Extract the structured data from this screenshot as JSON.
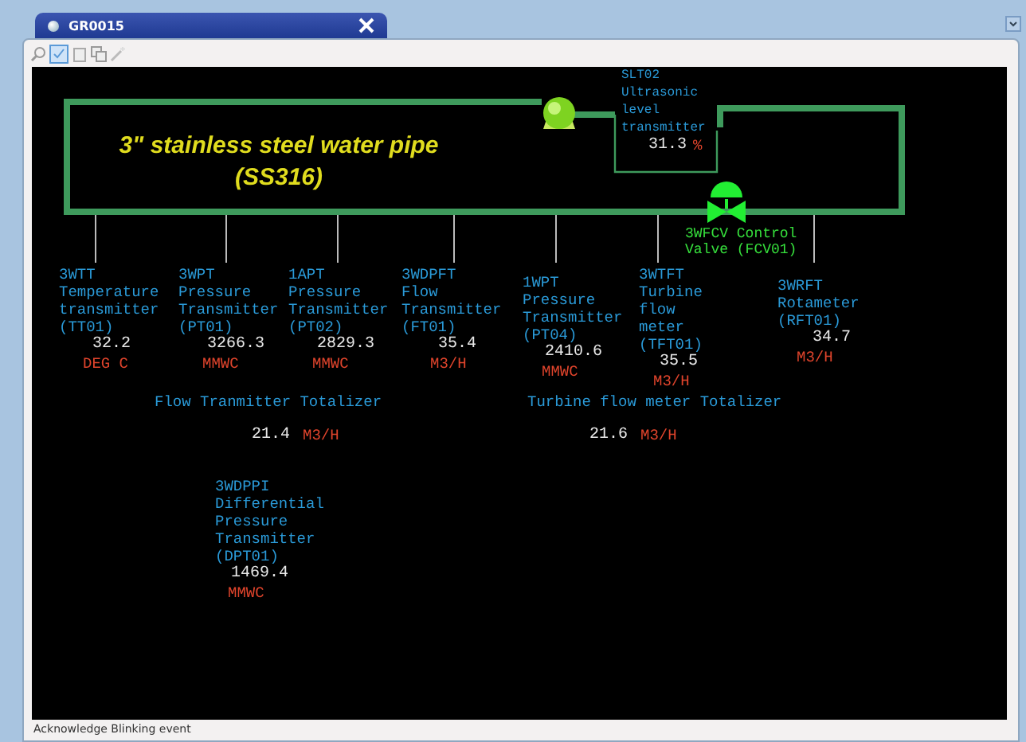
{
  "window": {
    "tab_title": "GR0015"
  },
  "pipe": {
    "label_lines": [
      "3\" stainless steel water pipe",
      "(SS316)"
    ]
  },
  "level_transmitter": {
    "label_lines": [
      "SLT02",
      "Ultrasonic",
      "level",
      "transmitter"
    ],
    "value": "31.3",
    "unit": "%"
  },
  "control_valve": {
    "label": "3WFCV Control Valve (FCV01)"
  },
  "instruments": [
    {
      "label_lines": [
        "3WTT",
        "Temperature",
        "transmitter",
        "(TT01)"
      ],
      "value": "32.2",
      "unit": "DEG C"
    },
    {
      "label_lines": [
        "3WPT",
        "Pressure",
        "Transmitter",
        "(PT01)"
      ],
      "value": "3266.3",
      "unit": "MMWC"
    },
    {
      "label_lines": [
        "1APT",
        "Pressure",
        "Transmitter",
        "(PT02)"
      ],
      "value": "2829.3",
      "unit": "MMWC"
    },
    {
      "label_lines": [
        "3WDPFT",
        "Flow",
        "Transmitter",
        "(FT01)"
      ],
      "value": "35.4",
      "unit": "M3/H"
    },
    {
      "label_lines": [
        "1WPT",
        "Pressure",
        "Transmitter",
        "(PT04)"
      ],
      "value": "2410.6",
      "unit": "MMWC"
    },
    {
      "label_lines": [
        "3WTFT",
        "Turbine",
        "flow",
        "meter",
        "(TFT01)"
      ],
      "value": "35.5",
      "unit": "M3/H"
    },
    {
      "label_lines": [
        "3WRFT",
        "Rotameter",
        "(RFT01)"
      ],
      "value": "34.7",
      "unit": "M3/H"
    },
    {
      "label_lines": [
        "3WDPPI",
        "Differential",
        "Pressure",
        "Transmitter",
        "(DPT01)"
      ],
      "value": "1469.4",
      "unit": "MMWC"
    }
  ],
  "totalizers": [
    {
      "label": "Flow Tranmitter Totalizer",
      "value": "21.4",
      "unit": "M3/H"
    },
    {
      "label": "Turbine flow meter Totalizer",
      "value": "21.6",
      "unit": "M3/H"
    }
  ],
  "status_bar": "Acknowledge Blinking event"
}
